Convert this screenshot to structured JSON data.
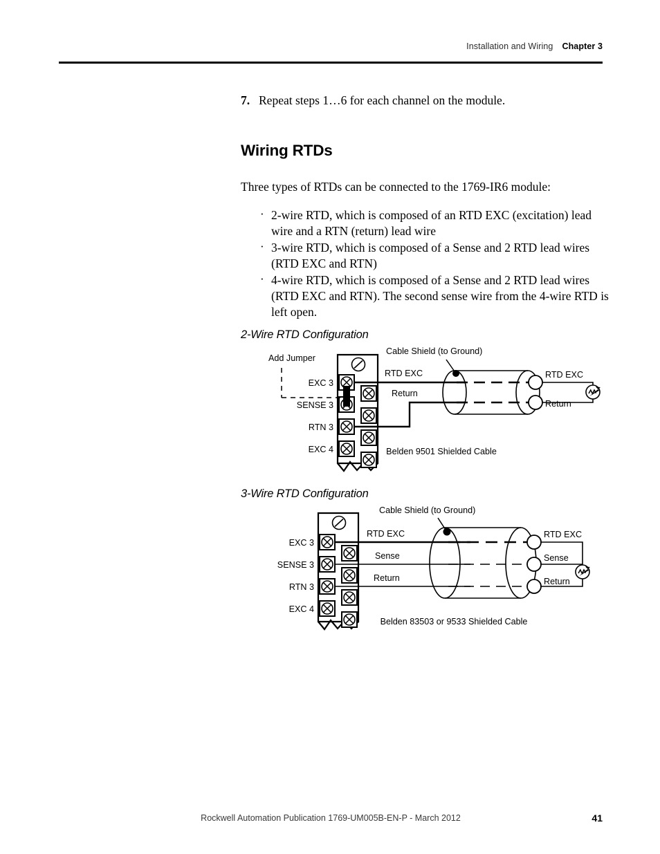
{
  "header": {
    "breadcrumb": "Installation and Wiring",
    "chapter": "Chapter 3"
  },
  "body": {
    "step": {
      "number": "7.",
      "text": "Repeat steps 1…6 for each channel on the module."
    },
    "section_heading": "Wiring RTDs",
    "intro": "Three types of RTDs can be connected to the 1769-IR6 module:",
    "bullets": [
      "2-wire RTD, which is composed of an RTD EXC (excitation) lead wire and a RTN (return) lead wire",
      "3-wire RTD, which is composed of a Sense and 2 RTD lead wires (RTD EXC and RTN)",
      "4-wire RTD, which is composed of a Sense and 2 RTD lead wires (RTD EXC and RTN). The second sense wire from the 4-wire RTD is left open."
    ]
  },
  "figures": {
    "two_wire": {
      "title": "2-Wire RTD Configuration",
      "jumper_label": "Add Jumper",
      "shield_label": "Cable Shield (to Ground)",
      "cable_caption": "Belden 9501 Shielded Cable",
      "terminals": [
        "EXC 3",
        "SENSE 3",
        "RTN 3",
        "EXC 4"
      ],
      "wire_labels": [
        "RTD EXC",
        "Return"
      ],
      "sensor_labels": [
        "RTD EXC",
        "Return"
      ]
    },
    "three_wire": {
      "title": "3-Wire RTD Configuration",
      "shield_label": "Cable Shield (to Ground)",
      "cable_caption": "Belden 83503 or 9533 Shielded Cable",
      "terminals": [
        "EXC 3",
        "SENSE 3",
        "RTN 3",
        "EXC 4"
      ],
      "wire_labels": [
        "RTD EXC",
        "Sense",
        "Return"
      ],
      "sensor_labels": [
        "RTD EXC",
        "Sense",
        "Return"
      ]
    }
  },
  "footer": {
    "publication": "Rockwell Automation Publication 1769-UM005B-EN-P - March 2012",
    "page_number": "41"
  }
}
